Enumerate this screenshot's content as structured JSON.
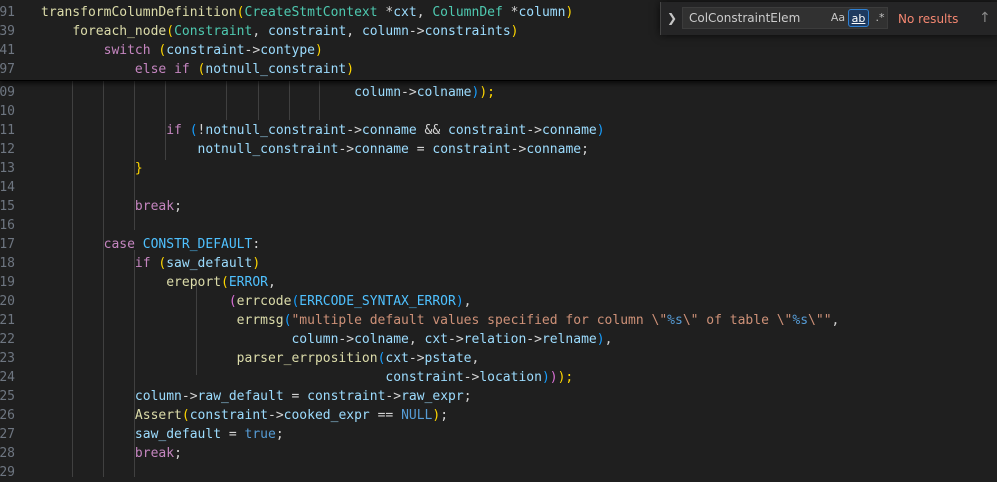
{
  "sticky_lines": [
    {
      "num": "91",
      "tokens": [
        [
          "transformColumnDefinition",
          "fn"
        ],
        [
          "(",
          "br1"
        ],
        [
          "CreateStmtContext",
          "ty"
        ],
        [
          " *",
          "pn"
        ],
        [
          "cxt",
          "va"
        ],
        [
          ", ",
          "pn"
        ],
        [
          "ColumnDef",
          "ty"
        ],
        [
          " *",
          "pn"
        ],
        [
          "column",
          "va"
        ],
        [
          ")",
          "br1"
        ]
      ]
    },
    {
      "num": "39",
      "tokens": [
        [
          "    ",
          "pn"
        ],
        [
          "foreach_node",
          "fn"
        ],
        [
          "(",
          "br1"
        ],
        [
          "Constraint",
          "ty"
        ],
        [
          ", ",
          "pn"
        ],
        [
          "constraint",
          "va"
        ],
        [
          ", ",
          "pn"
        ],
        [
          "column",
          "va"
        ],
        [
          "->",
          "pn"
        ],
        [
          "constraints",
          "va"
        ],
        [
          ")",
          "br1"
        ]
      ]
    },
    {
      "num": "41",
      "tokens": [
        [
          "        ",
          "pn"
        ],
        [
          "switch",
          "kw"
        ],
        [
          " ",
          "pn"
        ],
        [
          "(",
          "br1"
        ],
        [
          "constraint",
          "va"
        ],
        [
          "->",
          "pn"
        ],
        [
          "contype",
          "va"
        ],
        [
          ")",
          "br1"
        ]
      ]
    },
    {
      "num": "97",
      "tokens": [
        [
          "            ",
          "pn"
        ],
        [
          "else",
          "kw"
        ],
        [
          " ",
          "pn"
        ],
        [
          "if",
          "kw"
        ],
        [
          " ",
          "pn"
        ],
        [
          "(",
          "br1"
        ],
        [
          "notnull_constraint",
          "va"
        ],
        [
          ")",
          "br1"
        ]
      ]
    }
  ],
  "code_lines": [
    {
      "num": "09",
      "tokens": [
        [
          "                                        ",
          "pn"
        ],
        [
          "column",
          "va"
        ],
        [
          "->",
          "pn"
        ],
        [
          "colname",
          "va"
        ],
        [
          ")",
          "br3"
        ],
        [
          ");",
          "br1"
        ]
      ]
    },
    {
      "num": "10",
      "tokens": []
    },
    {
      "num": "11",
      "tokens": [
        [
          "                ",
          "pn"
        ],
        [
          "if",
          "kw"
        ],
        [
          " ",
          "pn"
        ],
        [
          "(",
          "br3"
        ],
        [
          "!",
          "pn"
        ],
        [
          "notnull_constraint",
          "va"
        ],
        [
          "->",
          "pn"
        ],
        [
          "conname",
          "va"
        ],
        [
          " && ",
          "pn"
        ],
        [
          "constraint",
          "va"
        ],
        [
          "->",
          "pn"
        ],
        [
          "conname",
          "va"
        ],
        [
          ")",
          "br3"
        ]
      ]
    },
    {
      "num": "12",
      "tokens": [
        [
          "                    ",
          "pn"
        ],
        [
          "notnull_constraint",
          "va"
        ],
        [
          "->",
          "pn"
        ],
        [
          "conname",
          "va"
        ],
        [
          " = ",
          "pn"
        ],
        [
          "constraint",
          "va"
        ],
        [
          "->",
          "pn"
        ],
        [
          "conname",
          "va"
        ],
        [
          ";",
          "pn"
        ]
      ]
    },
    {
      "num": "13",
      "tokens": [
        [
          "            ",
          "pn"
        ],
        [
          "}",
          "br1"
        ]
      ]
    },
    {
      "num": "14",
      "tokens": []
    },
    {
      "num": "15",
      "tokens": [
        [
          "            ",
          "pn"
        ],
        [
          "break",
          "kw"
        ],
        [
          ";",
          "pn"
        ]
      ]
    },
    {
      "num": "16",
      "tokens": []
    },
    {
      "num": "17",
      "tokens": [
        [
          "        ",
          "pn"
        ],
        [
          "case",
          "kw"
        ],
        [
          " ",
          "pn"
        ],
        [
          "CONSTR_DEFAULT",
          "cn"
        ],
        [
          ":",
          "pn"
        ]
      ]
    },
    {
      "num": "18",
      "tokens": [
        [
          "            ",
          "pn"
        ],
        [
          "if",
          "kw"
        ],
        [
          " ",
          "pn"
        ],
        [
          "(",
          "br1"
        ],
        [
          "saw_default",
          "va"
        ],
        [
          ")",
          "br1"
        ]
      ]
    },
    {
      "num": "19",
      "tokens": [
        [
          "                ",
          "pn"
        ],
        [
          "ereport",
          "fn"
        ],
        [
          "(",
          "br1"
        ],
        [
          "ERROR",
          "cn"
        ],
        [
          ",",
          "pn"
        ]
      ]
    },
    {
      "num": "20",
      "tokens": [
        [
          "                        ",
          "pn"
        ],
        [
          "(",
          "br2"
        ],
        [
          "errcode",
          "fn"
        ],
        [
          "(",
          "br3"
        ],
        [
          "ERRCODE_SYNTAX_ERROR",
          "cn"
        ],
        [
          ")",
          "br3"
        ],
        [
          ",",
          "pn"
        ]
      ]
    },
    {
      "num": "21",
      "tokens": [
        [
          "                         ",
          "pn"
        ],
        [
          "errmsg",
          "fn"
        ],
        [
          "(",
          "br3"
        ],
        [
          "\"multiple default values specified for column \\\"",
          "st"
        ],
        [
          "%s",
          "bl"
        ],
        [
          "\\\" of table \\\"",
          "st"
        ],
        [
          "%s",
          "bl"
        ],
        [
          "\\\"\"",
          "st"
        ],
        [
          ",",
          "pn"
        ]
      ]
    },
    {
      "num": "22",
      "tokens": [
        [
          "                                ",
          "pn"
        ],
        [
          "column",
          "va"
        ],
        [
          "->",
          "pn"
        ],
        [
          "colname",
          "va"
        ],
        [
          ", ",
          "pn"
        ],
        [
          "cxt",
          "va"
        ],
        [
          "->",
          "pn"
        ],
        [
          "relation",
          "va"
        ],
        [
          "->",
          "pn"
        ],
        [
          "relname",
          "va"
        ],
        [
          ")",
          "br3"
        ],
        [
          ",",
          "pn"
        ]
      ]
    },
    {
      "num": "23",
      "tokens": [
        [
          "                         ",
          "pn"
        ],
        [
          "parser_errposition",
          "fn"
        ],
        [
          "(",
          "br3"
        ],
        [
          "cxt",
          "va"
        ],
        [
          "->",
          "pn"
        ],
        [
          "pstate",
          "va"
        ],
        [
          ",",
          "pn"
        ]
      ]
    },
    {
      "num": "24",
      "tokens": [
        [
          "                                            ",
          "pn"
        ],
        [
          "constraint",
          "va"
        ],
        [
          "->",
          "pn"
        ],
        [
          "location",
          "va"
        ],
        [
          ")",
          "br3"
        ],
        [
          ")",
          "br2"
        ],
        [
          ");",
          "br1"
        ]
      ]
    },
    {
      "num": "25",
      "tokens": [
        [
          "            ",
          "pn"
        ],
        [
          "column",
          "va"
        ],
        [
          "->",
          "pn"
        ],
        [
          "raw_default",
          "va"
        ],
        [
          " = ",
          "pn"
        ],
        [
          "constraint",
          "va"
        ],
        [
          "->",
          "pn"
        ],
        [
          "raw_expr",
          "va"
        ],
        [
          ";",
          "pn"
        ]
      ]
    },
    {
      "num": "26",
      "tokens": [
        [
          "            ",
          "pn"
        ],
        [
          "Assert",
          "fn"
        ],
        [
          "(",
          "br1"
        ],
        [
          "constraint",
          "va"
        ],
        [
          "->",
          "pn"
        ],
        [
          "cooked_expr",
          "va"
        ],
        [
          " == ",
          "pn"
        ],
        [
          "NULL",
          "bl"
        ],
        [
          ")",
          "br1"
        ],
        [
          ";",
          "pn"
        ]
      ]
    },
    {
      "num": "27",
      "tokens": [
        [
          "            ",
          "pn"
        ],
        [
          "saw_default",
          "va"
        ],
        [
          " = ",
          "pn"
        ],
        [
          "true",
          "bl"
        ],
        [
          ";",
          "pn"
        ]
      ]
    },
    {
      "num": "28",
      "tokens": [
        [
          "            ",
          "pn"
        ],
        [
          "break",
          "kw"
        ],
        [
          ";",
          "pn"
        ]
      ]
    },
    {
      "num": "29",
      "tokens": []
    }
  ],
  "find_widget": {
    "toggle_icon": "chevron-right-icon",
    "search_value": "ColConstraintElem",
    "match_case_label": "Aa",
    "whole_word_label": "ab",
    "regex_label": ".*",
    "status": "No results",
    "prev_icon": "arrow-up-icon"
  },
  "colors": {
    "background": "#1f1f1f",
    "line_number": "#6e7681",
    "no_results": "#f48771"
  }
}
